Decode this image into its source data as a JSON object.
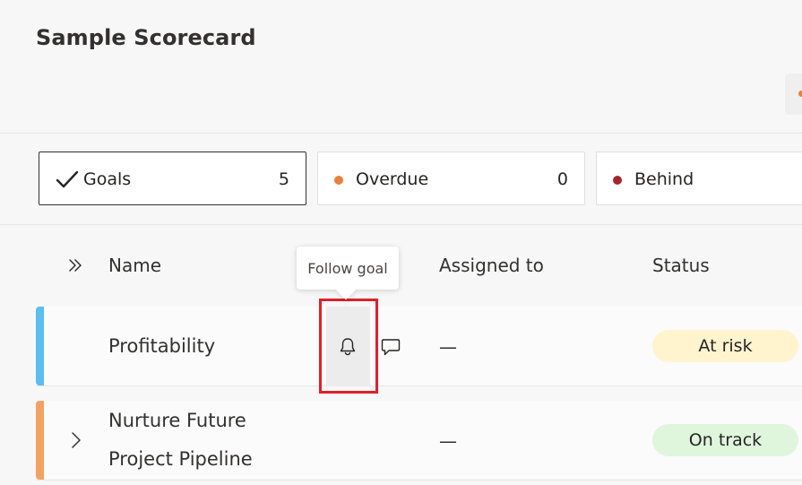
{
  "header": {
    "title": "Sample Scorecard"
  },
  "summary": [
    {
      "label": "Goals",
      "count": "5",
      "selected": true
    },
    {
      "label": "Overdue",
      "count": "0",
      "dot_color": "#e8803c"
    },
    {
      "label": "Behind",
      "count": "",
      "dot_color": "#a4262c"
    }
  ],
  "columns": {
    "name": "Name",
    "assigned": "Assigned to",
    "status": "Status"
  },
  "tooltip": {
    "text": "Follow goal"
  },
  "rows": [
    {
      "name": "Profitability",
      "assigned": "—",
      "status": "At risk",
      "status_color": "#fff4ce",
      "bar_color": "#5bbdf0"
    },
    {
      "name_line1": "Nurture Future",
      "name_line2": "Project Pipeline",
      "assigned": "—",
      "status": "On track",
      "status_color": "#dff6dd",
      "bar_color": "#f4a261"
    }
  ],
  "icons": {
    "check": "checkmark-icon",
    "expand_all": "double-chevron-right-icon",
    "bell": "bell-icon",
    "comment": "comment-icon",
    "row_expand": "chevron-right-icon"
  }
}
